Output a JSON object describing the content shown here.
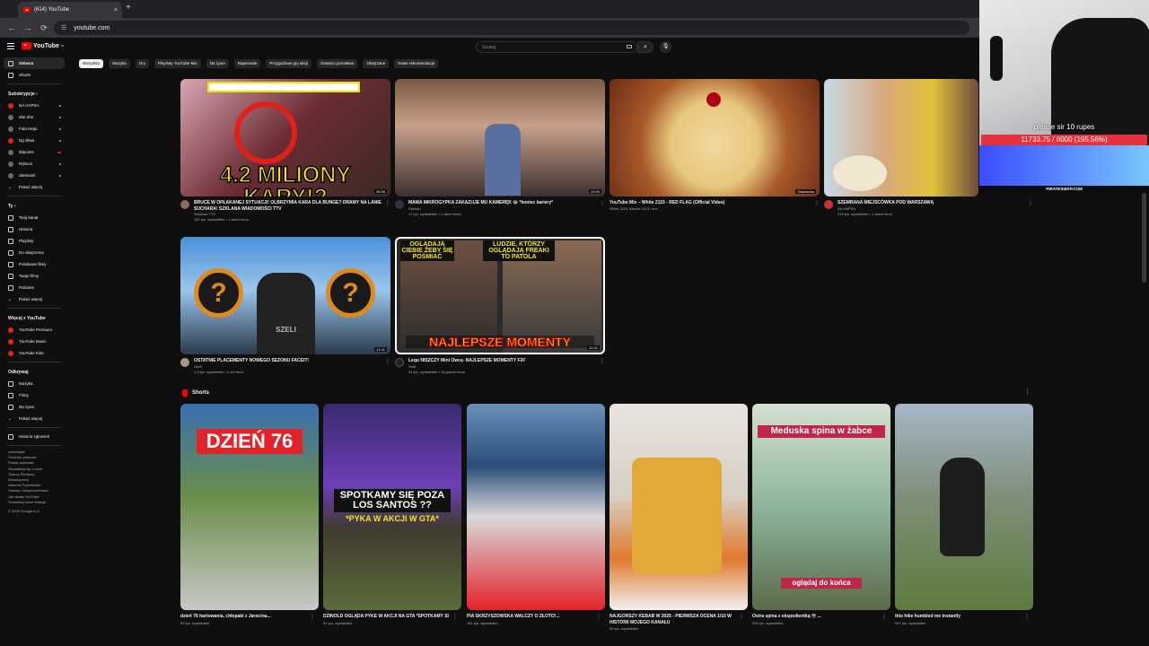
{
  "browser": {
    "tab_title": "(614) YouTube",
    "tab_close": "×",
    "new_tab": "+",
    "url": "youtube.com",
    "back": "←",
    "forward": "→",
    "reload": "⟳"
  },
  "masthead": {
    "logo": "YouTube",
    "logo_region": "PL",
    "search_placeholder": "Szukaj",
    "search_icon": "⌕",
    "mic_icon": "🎙"
  },
  "sidebar": {
    "main": [
      "Główna",
      "Shorts"
    ],
    "subs_header": "Subskrypcje",
    "subs": [
      "NA HAPSA",
      "ebe ebe",
      "Fala Hejtu",
      "Dg sllwa",
      "bitpoints",
      "Rybson",
      "Siemiank"
    ],
    "show_more": "Pokaż więcej",
    "you_header": "Ty",
    "you": [
      "Twój kanał",
      "Historia",
      "Playlisty",
      "Do obejrzenia",
      "Polubione filmy",
      "Twoje filmy",
      "Pobrane"
    ],
    "more_header": "Więcej z YouTube",
    "more": [
      "YouTube Premium",
      "YouTube Music",
      "YouTube Kids"
    ],
    "explore_header": "Odkrywaj",
    "explore": [
      "Muzyka",
      "Filmy",
      "Na żywo"
    ],
    "history_report": "Historia zgłoszeń",
    "footer_lines": [
      "Informacje",
      "Centrum prasowe",
      "Prawa autorskie",
      "Skontaktuj się z nami",
      "Twórcy   Reklamy",
      "Deweloperzy",
      "",
      "Warunki   Prywatność",
      "Zasady i bezpieczeństwo",
      "Jak działa YouTube",
      "Przetestuj nowe funkcje",
      "",
      "© 2025 Google LLC"
    ]
  },
  "chips": [
    "Wszystko",
    "Muzyka",
    "Gry",
    "Playlisty YouTube Mix",
    "Na żywo",
    "Raperowie",
    "Przygodowe gry akcji",
    "Ostatnio przesłane",
    "Obejrzane",
    "Nowe rekomendacje"
  ],
  "videos": [
    {
      "title": "BRUCE W OPŁAKANEJ SYTUACJI! OLBRZYMIA KARA DLA BUNGE? DRAMY NA LANIE SUCHARA! SZKLANA WIADOMOŚCI TTV",
      "channel": "Szklana+TTV",
      "stats": "100 tys. wyświetleń • 1 dzień temu",
      "duration": "36:58",
      "thumb_text": "4.2 MILIONY KARY!?"
    },
    {
      "title": "MAMA MIKROGYPKA ZAKAZUJE MU KAMERĘK 😂 *koniec kariery*",
      "channel": "Rybson",
      "stats": "17 tys. wyświetleń • 1 dzień temu",
      "duration": "24:50",
      "thumb_text": ""
    },
    {
      "title": "YouTube Mix – White 2115 - RED FLAG (Official Video)",
      "channel": "White 2115, Blacha 2115 i inni",
      "stats": "",
      "duration": "Składanka",
      "thumb_text": ""
    },
    {
      "title": "SZEMRANA MIEJSCÓWKA POD WARSZAWĄ",
      "channel": "NA HAPSA",
      "stats": "219 tys. wyświetleń • 1 dzień temu",
      "duration": "",
      "thumb_text": ""
    },
    {
      "title": "OSTATNIE PLACEMENTY NOWEGO SEZONU FACEIT!",
      "channel": "Szeli",
      "stats": "1,9 tys. wyświetleń • 2 dni temu",
      "duration": "17:41",
      "thumb_text": "SZELI"
    },
    {
      "title": "Lequ NISZCZY Mini Owcę- NAJLEPSZE MOMENTY F2F",
      "channel": "Sebi",
      "stats": "34 tys. wyświetleń • 18 godzin temu",
      "duration": "20:31",
      "thumb_text": "NAJLEPSZE MOMENTY"
    }
  ],
  "thumb_captions": {
    "v5_left": "OGLĄDAJĄ CIEBIE ŻEBY SIĘ POŚMIAĆ",
    "v5_right": "LUDZIE, KTÓRZY OGLĄDAJĄ FREAKI TO PATOLA"
  },
  "shorts_header": "Shorts",
  "shorts": [
    {
      "title": "dzień 76 hartowania, chłopaki z Jarocina...",
      "views": "53 tys. wyświetleń",
      "overlay": "DZIEŃ 76"
    },
    {
      "title": "DZINOLD OGLĄDA PYKE W AKCJI NA GTA *SPOTKAMY SIĘ POZA LS?*...",
      "views": "91 tys. wyświetleń",
      "overlay": "SPOTKAMY SIĘ POZA LOS SANTOS ??",
      "overlay2": "*PYKA W AKCJI W GTA*"
    },
    {
      "title": "PIA SKRZYSZOWSKA WALCZY O ZŁOTO!...",
      "views": "181 tys. wyświetleń",
      "overlay": ""
    },
    {
      "title": "NAJGORSZY KEBAB W 2025 - PIERWSZA OCENA 1/10 W HISTORII MOJEGO KANAŁU",
      "views": "50 tys. wyświetleń",
      "overlay": ""
    },
    {
      "title": "Ostra spina z ekspedientką 😳 ...",
      "views": "200 tys. wyświetleń",
      "overlay": "Meduska spina w żabce",
      "overlay2": "oglądaj do końca"
    },
    {
      "title": "this hike humbled me instantly",
      "views": "947 tys. wyświetleń",
      "overlay": ""
    }
  ],
  "webcam": {
    "message": "please sir 10 rupes",
    "goal": "11733.75 / 6000 (195.56%)",
    "goal_progress": 1.9556,
    "url": "PIRATESWAP.COM"
  },
  "icons": {
    "kebab": "⋮",
    "chevron": "›",
    "chevron_down": "⌄"
  }
}
